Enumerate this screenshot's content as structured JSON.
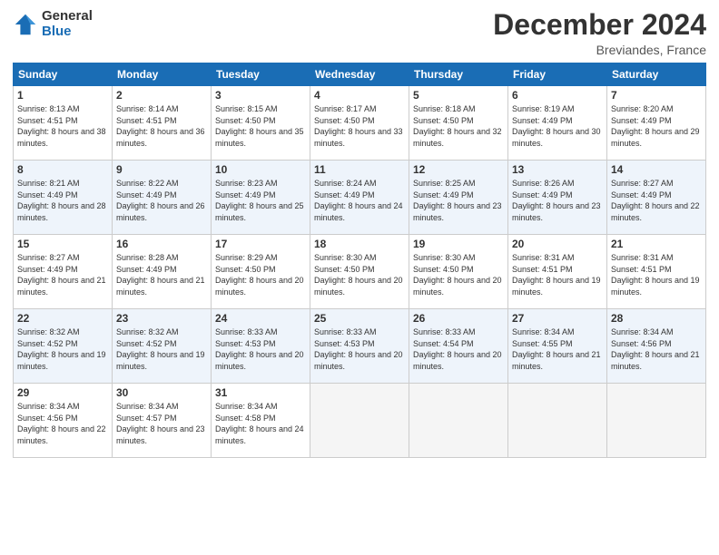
{
  "header": {
    "logo_general": "General",
    "logo_blue": "Blue",
    "month_title": "December 2024",
    "location": "Breviandes, France"
  },
  "days_of_week": [
    "Sunday",
    "Monday",
    "Tuesday",
    "Wednesday",
    "Thursday",
    "Friday",
    "Saturday"
  ],
  "weeks": [
    [
      {
        "day": "1",
        "sunrise": "8:13 AM",
        "sunset": "4:51 PM",
        "daylight": "8 hours and 38 minutes."
      },
      {
        "day": "2",
        "sunrise": "8:14 AM",
        "sunset": "4:51 PM",
        "daylight": "8 hours and 36 minutes."
      },
      {
        "day": "3",
        "sunrise": "8:15 AM",
        "sunset": "4:50 PM",
        "daylight": "8 hours and 35 minutes."
      },
      {
        "day": "4",
        "sunrise": "8:17 AM",
        "sunset": "4:50 PM",
        "daylight": "8 hours and 33 minutes."
      },
      {
        "day": "5",
        "sunrise": "8:18 AM",
        "sunset": "4:50 PM",
        "daylight": "8 hours and 32 minutes."
      },
      {
        "day": "6",
        "sunrise": "8:19 AM",
        "sunset": "4:49 PM",
        "daylight": "8 hours and 30 minutes."
      },
      {
        "day": "7",
        "sunrise": "8:20 AM",
        "sunset": "4:49 PM",
        "daylight": "8 hours and 29 minutes."
      }
    ],
    [
      {
        "day": "8",
        "sunrise": "8:21 AM",
        "sunset": "4:49 PM",
        "daylight": "8 hours and 28 minutes."
      },
      {
        "day": "9",
        "sunrise": "8:22 AM",
        "sunset": "4:49 PM",
        "daylight": "8 hours and 26 minutes."
      },
      {
        "day": "10",
        "sunrise": "8:23 AM",
        "sunset": "4:49 PM",
        "daylight": "8 hours and 25 minutes."
      },
      {
        "day": "11",
        "sunrise": "8:24 AM",
        "sunset": "4:49 PM",
        "daylight": "8 hours and 24 minutes."
      },
      {
        "day": "12",
        "sunrise": "8:25 AM",
        "sunset": "4:49 PM",
        "daylight": "8 hours and 23 minutes."
      },
      {
        "day": "13",
        "sunrise": "8:26 AM",
        "sunset": "4:49 PM",
        "daylight": "8 hours and 23 minutes."
      },
      {
        "day": "14",
        "sunrise": "8:27 AM",
        "sunset": "4:49 PM",
        "daylight": "8 hours and 22 minutes."
      }
    ],
    [
      {
        "day": "15",
        "sunrise": "8:27 AM",
        "sunset": "4:49 PM",
        "daylight": "8 hours and 21 minutes."
      },
      {
        "day": "16",
        "sunrise": "8:28 AM",
        "sunset": "4:49 PM",
        "daylight": "8 hours and 21 minutes."
      },
      {
        "day": "17",
        "sunrise": "8:29 AM",
        "sunset": "4:50 PM",
        "daylight": "8 hours and 20 minutes."
      },
      {
        "day": "18",
        "sunrise": "8:30 AM",
        "sunset": "4:50 PM",
        "daylight": "8 hours and 20 minutes."
      },
      {
        "day": "19",
        "sunrise": "8:30 AM",
        "sunset": "4:50 PM",
        "daylight": "8 hours and 20 minutes."
      },
      {
        "day": "20",
        "sunrise": "8:31 AM",
        "sunset": "4:51 PM",
        "daylight": "8 hours and 19 minutes."
      },
      {
        "day": "21",
        "sunrise": "8:31 AM",
        "sunset": "4:51 PM",
        "daylight": "8 hours and 19 minutes."
      }
    ],
    [
      {
        "day": "22",
        "sunrise": "8:32 AM",
        "sunset": "4:52 PM",
        "daylight": "8 hours and 19 minutes."
      },
      {
        "day": "23",
        "sunrise": "8:32 AM",
        "sunset": "4:52 PM",
        "daylight": "8 hours and 19 minutes."
      },
      {
        "day": "24",
        "sunrise": "8:33 AM",
        "sunset": "4:53 PM",
        "daylight": "8 hours and 20 minutes."
      },
      {
        "day": "25",
        "sunrise": "8:33 AM",
        "sunset": "4:53 PM",
        "daylight": "8 hours and 20 minutes."
      },
      {
        "day": "26",
        "sunrise": "8:33 AM",
        "sunset": "4:54 PM",
        "daylight": "8 hours and 20 minutes."
      },
      {
        "day": "27",
        "sunrise": "8:34 AM",
        "sunset": "4:55 PM",
        "daylight": "8 hours and 21 minutes."
      },
      {
        "day": "28",
        "sunrise": "8:34 AM",
        "sunset": "4:56 PM",
        "daylight": "8 hours and 21 minutes."
      }
    ],
    [
      {
        "day": "29",
        "sunrise": "8:34 AM",
        "sunset": "4:56 PM",
        "daylight": "8 hours and 22 minutes."
      },
      {
        "day": "30",
        "sunrise": "8:34 AM",
        "sunset": "4:57 PM",
        "daylight": "8 hours and 23 minutes."
      },
      {
        "day": "31",
        "sunrise": "8:34 AM",
        "sunset": "4:58 PM",
        "daylight": "8 hours and 24 minutes."
      },
      null,
      null,
      null,
      null
    ]
  ]
}
